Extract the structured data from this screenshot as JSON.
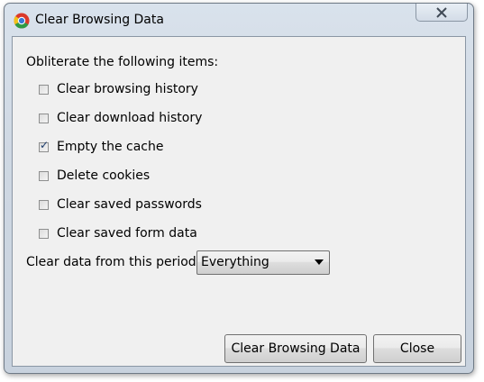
{
  "window": {
    "title": "Clear Browsing Data",
    "app_icon": "chrome-icon",
    "close_icon": "close-icon"
  },
  "dialog": {
    "heading": "Obliterate the following items:",
    "options": [
      {
        "label": "Clear browsing history",
        "checked": false
      },
      {
        "label": "Clear download history",
        "checked": false
      },
      {
        "label": "Empty the cache",
        "checked": true
      },
      {
        "label": "Delete cookies",
        "checked": false
      },
      {
        "label": "Clear saved passwords",
        "checked": false
      },
      {
        "label": "Clear saved form data",
        "checked": false
      }
    ],
    "period": {
      "label": "Clear data from this period:",
      "selected": "Everything"
    },
    "buttons": {
      "primary": "Clear Browsing Data",
      "close": "Close"
    }
  },
  "colors": {
    "frame": "#cfd8e3",
    "client": "#f0f0f0",
    "check": "#1a3a6b"
  }
}
